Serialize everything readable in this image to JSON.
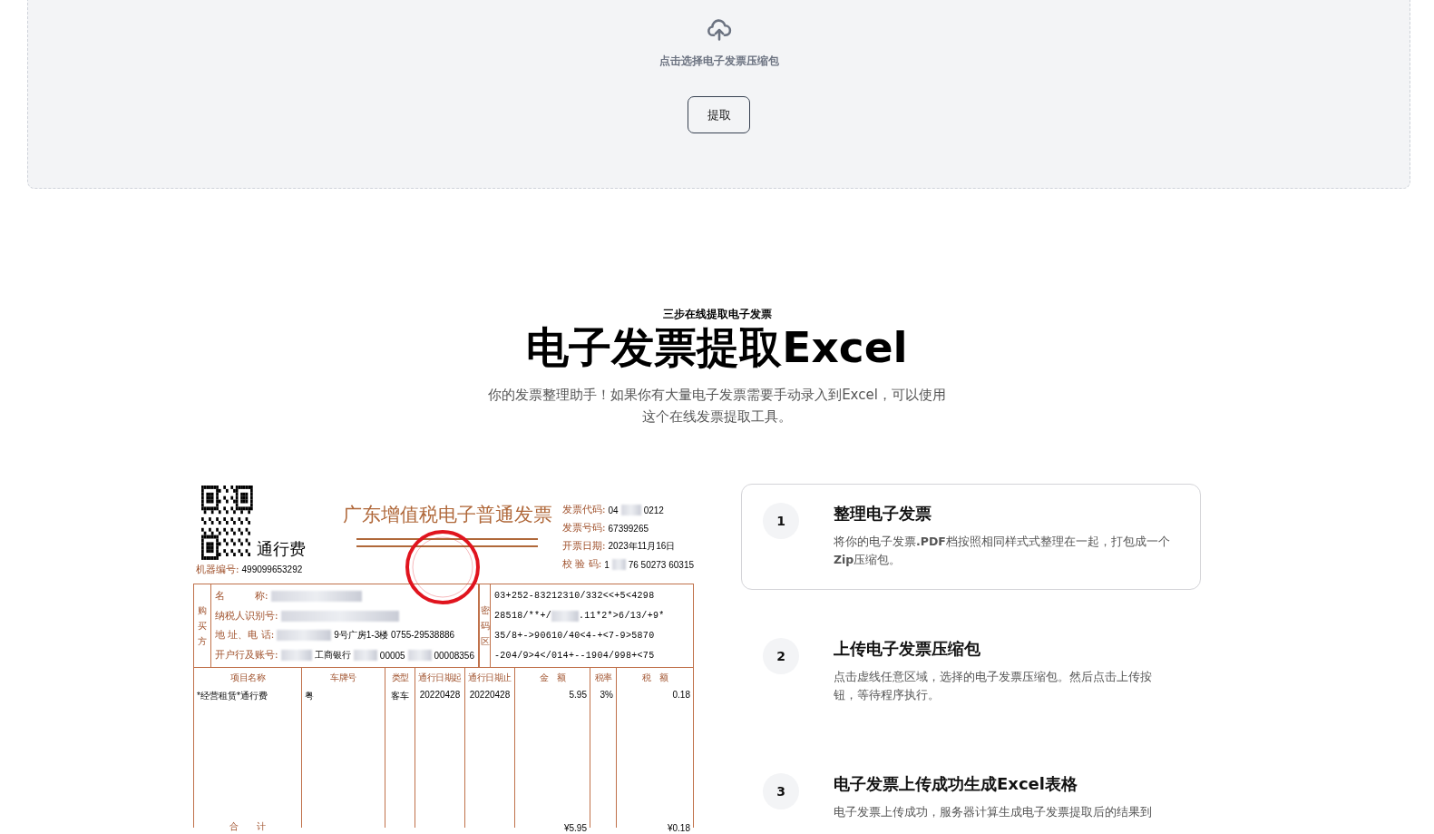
{
  "upload": {
    "prompt": "点击选择电子发票压缩包",
    "button": "提取"
  },
  "hero": {
    "eyebrow": "三步在线提取电子发票",
    "title": "电子发票提取Excel",
    "description": "你的发票整理助手！如果你有大量电子发票需要手动录入到Excel，可以使用这个在线发票提取工具。"
  },
  "invoice": {
    "title": "广东增值税电子普通发票",
    "category": "通行费",
    "machine_label": "机器编号:",
    "machine_no": "499099653292",
    "meta": [
      {
        "label": "发票代码:",
        "parts": [
          "04",
          "0212"
        ]
      },
      {
        "label": "发票号码:",
        "parts": [
          "67399265"
        ]
      },
      {
        "label": "开票日期:",
        "parts": [
          "2023年11月16日"
        ]
      },
      {
        "label": "校 验 码:",
        "parts": [
          "1",
          "76 50273 60315"
        ]
      }
    ],
    "buyer_label": "购买方",
    "buyer_fields": [
      {
        "label": "名　　　称:"
      },
      {
        "label": "纳税人识别号:"
      },
      {
        "label": "地 址、电 话:",
        "parts": [
          "9号广房1-3楼 0755-29538886"
        ]
      },
      {
        "label": "开户行及账号:",
        "parts": [
          "工商银行",
          "00005",
          "00008356"
        ]
      }
    ],
    "cipher_label": "密码区",
    "cipher_lines": [
      {
        "parts": [
          "03+252-83212310/332<<+5<4298"
        ]
      },
      {
        "parts": [
          "28518/**+/",
          ".11*2*>6/13/+9*"
        ]
      },
      {
        "parts": [
          "35/8+->90610/40<4-+<7-9>5870"
        ]
      },
      {
        "parts": [
          "-204/9>4</014+--1904/998+<75"
        ]
      }
    ],
    "columns": [
      "项目名称",
      "车牌号",
      "类型",
      "通行日期起",
      "通行日期止",
      "金　额",
      "税率",
      "税　额"
    ],
    "rows": [
      [
        "*经营租赁*通行费",
        "粤",
        "客车",
        "20220428",
        "20220428",
        "5.95",
        "3%",
        "0.18"
      ]
    ],
    "total_label": "合　　计",
    "total_amount": "¥5.95",
    "total_tax": "¥0.18"
  },
  "steps": [
    {
      "number": "1",
      "title": "整理电子发票",
      "description": "将你的电子发票**.PDF**档按照相同样式式整理在一起，打包成一个**Zip**压缩包。",
      "selected": true
    },
    {
      "number": "2",
      "title": "上传电子发票压缩包",
      "description": "点击虚线任意区域，选择的电子发票压缩包。然后点击上传按钮，等待程序执行。",
      "selected": false
    },
    {
      "number": "3",
      "title": "电子发票上传成功生成Excel表格",
      "description": "电子发票上传成功，服务器计算生成电子发票提取后的结果到",
      "selected": false
    }
  ]
}
